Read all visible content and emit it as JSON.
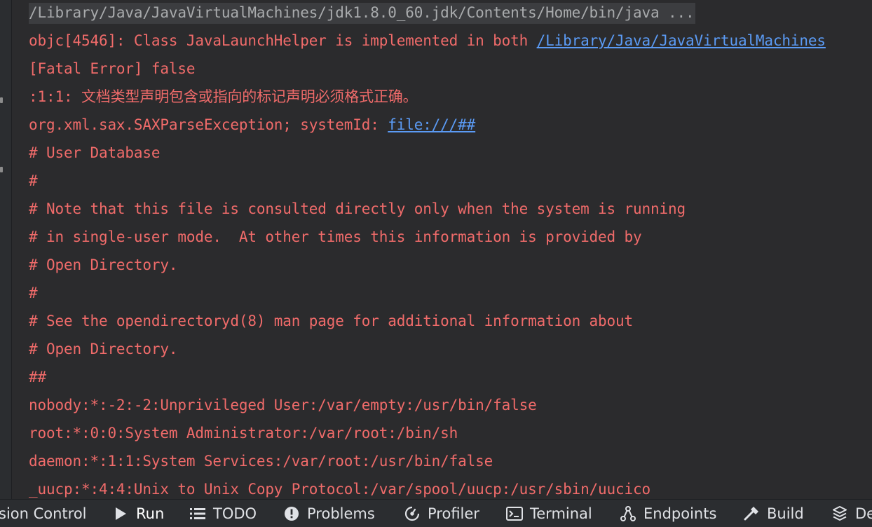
{
  "console": {
    "command": "/Library/Java/JavaVirtualMachines/jdk1.8.0_60.jdk/Contents/Home/bin/java ...",
    "lines": [
      {
        "text": "objc[4546]: Class JavaLaunchHelper is implemented in both ",
        "link": "/Library/Java/JavaVirtualMachines"
      },
      {
        "text": "[Fatal Error] false",
        "link": ""
      },
      {
        "text": ":1:1: 文档类型声明包含或指向的标记声明必须格式正确。",
        "link": ""
      },
      {
        "text": "org.xml.sax.SAXParseException; systemId: ",
        "link": "file:///##"
      },
      {
        "text": "# User Database",
        "link": ""
      },
      {
        "text": "#",
        "link": ""
      },
      {
        "text": "# Note that this file is consulted directly only when the system is running",
        "link": ""
      },
      {
        "text": "# in single-user mode.  At other times this information is provided by",
        "link": ""
      },
      {
        "text": "# Open Directory.",
        "link": ""
      },
      {
        "text": "#",
        "link": ""
      },
      {
        "text": "# See the opendirectoryd(8) man page for additional information about",
        "link": ""
      },
      {
        "text": "# Open Directory.",
        "link": ""
      },
      {
        "text": "##",
        "link": ""
      },
      {
        "text": "nobody:*:-2:-2:Unprivileged User:/var/empty:/usr/bin/false",
        "link": ""
      },
      {
        "text": "root:*:0:0:System Administrator:/var/root:/bin/sh",
        "link": ""
      },
      {
        "text": "daemon:*:1:1:System Services:/var/root:/usr/bin/false",
        "link": ""
      },
      {
        "text": "_uucp:*:4:4:Unix to Unix Copy Protocol:/var/spool/uucp:/usr/sbin/uucico",
        "link": ""
      }
    ]
  },
  "toolbar": {
    "tabs": [
      {
        "label": "sion Control",
        "icon": "version-control-icon"
      },
      {
        "label": "Run",
        "icon": "run-icon",
        "active": true
      },
      {
        "label": "TODO",
        "icon": "todo-list-icon"
      },
      {
        "label": "Problems",
        "icon": "problems-icon"
      },
      {
        "label": "Profiler",
        "icon": "profiler-icon"
      },
      {
        "label": "Terminal",
        "icon": "terminal-icon"
      },
      {
        "label": "Endpoints",
        "icon": "endpoints-icon"
      },
      {
        "label": "Build",
        "icon": "build-hammer-icon"
      },
      {
        "label": "De",
        "icon": "dependencies-icon"
      }
    ]
  },
  "colors": {
    "background": "#2b2b2d",
    "error_text": "#f06b6a",
    "command_text": "#a9abad",
    "link": "#5b9bf5",
    "toolbar_bg": "#2b2d30",
    "accent": "#3574f0"
  }
}
